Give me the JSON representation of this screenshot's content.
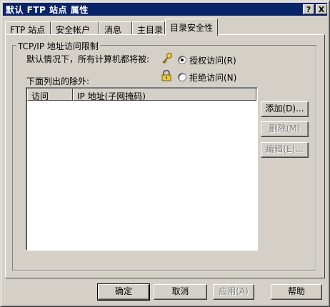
{
  "window": {
    "title": "默认 FTP 站点 属性",
    "help_glyph": "?",
    "close_glyph": "X"
  },
  "tabs": [
    {
      "label": "FTP 站点"
    },
    {
      "label": "安全帐户"
    },
    {
      "label": "消息"
    },
    {
      "label": "主目录"
    },
    {
      "label": "目录安全性"
    }
  ],
  "access": {
    "group_title": "TCP/IP 地址访问限制",
    "default_text": "默认情况下，所有计算机都将被:",
    "grant_label": "授权访问(R)",
    "deny_label": "拒绝访问(N)",
    "grant_icon": "key-icon",
    "deny_icon": "padlock-icon",
    "selected": "grant",
    "exceptions_label": "下面列出的除外:",
    "columns": [
      "访问",
      "IP 地址(子网掩码)"
    ],
    "rows": []
  },
  "side_buttons": {
    "add": "添加(D)...",
    "remove": "删除(M)",
    "edit": "编辑(E)..."
  },
  "footer": {
    "ok": "确定",
    "cancel": "取消",
    "apply": "应用(A)",
    "help": "帮助"
  }
}
